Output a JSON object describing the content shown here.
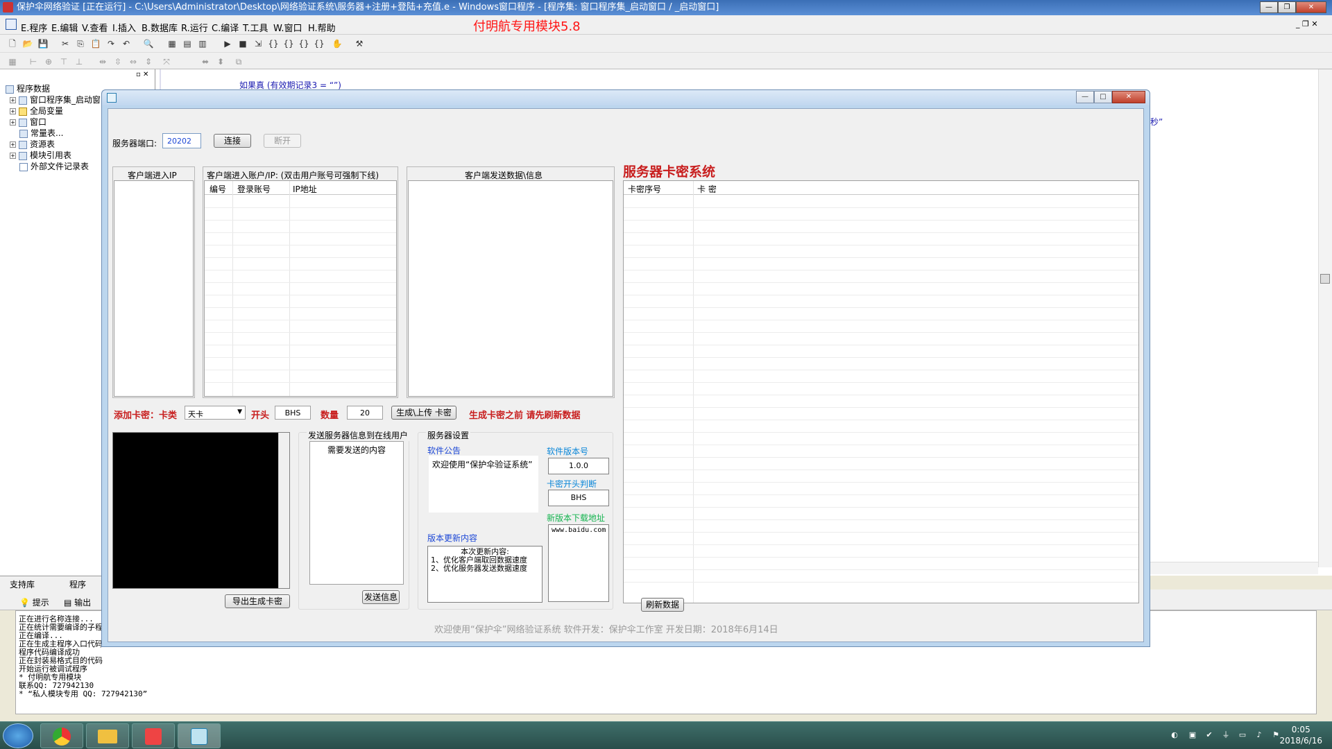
{
  "ide": {
    "title": "保护伞网络验证 [正在运行] - C:\\Users\\Administrator\\Desktop\\网络验证系统\\服务器+注册+登陆+充值.e - Windows窗口程序 - [程序集: 窗口程序集_启动窗口 / _启动窗口]",
    "menu": [
      "E.程序",
      "E.编辑",
      "V.查看",
      "I.插入",
      "B.数据库",
      "R.运行",
      "C.编译",
      "T.工具",
      "W.窗口",
      "H.帮助"
    ],
    "red_label": "付明航专用模块5.8",
    "tree": {
      "root": "程序数据",
      "items": [
        "窗口程序集_启动窗",
        "全局变量",
        "窗口",
        "常量表...",
        "资源表",
        "模块引用表",
        "外部文件记录表"
      ]
    },
    "left_tabs": [
      "支持库",
      "程序"
    ],
    "code_line": "如果真 (有效期记录3 = “”)",
    "code_fragment": "秒”",
    "output_tabs": [
      "提示",
      "输出"
    ],
    "output_lines": [
      "正在进行名称连接...",
      "正在统计需要编译的子程序",
      "正在编译...",
      "正在生成主程序入口代码",
      "程序代码编译成功",
      "正在封装易格式目的代码",
      "开始运行被调试程序",
      "* 付明航专用模块",
      "联系QQ: 727942130",
      "* “私人模块专用 QQ: 727942130”"
    ],
    "clock_time": "0:05",
    "clock_date": "2018/6/16"
  },
  "dialog": {
    "controls": {
      "minimize": "—",
      "maximize": "□",
      "close": "✕"
    },
    "port_label": "服务器端口:",
    "port_value": "20202",
    "connect_label": "连接",
    "disconnect_label": "断开",
    "client_ip_title": "客户端进入IP",
    "client_accounts_title": "客户端进入账户/IP: (双击用户账号可强制下线)",
    "client_accounts_columns": [
      "编号",
      "登录账号",
      "IP地址"
    ],
    "client_data_title": "客户端发送数据\\信息",
    "server_card_title": "服务器卡密系统",
    "card_columns": [
      "卡密序号",
      "卡 密"
    ],
    "add_card_label": "添加卡密：卡类",
    "card_type_value": "天卡",
    "prefix_label": "开头",
    "prefix_value": "BHS",
    "count_label": "数量",
    "count_value": "20",
    "generate_button": "生成\\上传 卡密",
    "generate_hint": "生成卡密之前 请先刷新数据",
    "send_title": "发送服务器信息到在线用户",
    "send_content": "需要发送的内容",
    "send_button": "发送信息",
    "export_button": "导出生成卡密",
    "server_settings_title": "服务器设置",
    "notice_label": "软件公告",
    "notice_value": "欢迎使用“保护伞验证系统”",
    "version_label": "软件版本号",
    "version_value": "1.0.0",
    "card_prefix_check_label": "卡密开头判断",
    "card_prefix_check_value": "BHS",
    "download_label": "新版本下载地址",
    "download_value": "www.baidu.com",
    "update_label": "版本更新内容",
    "update_lines": [
      "本次更新内容:",
      "1、优化客户端取回数据速度",
      "2、优化服务器发送数据速度"
    ],
    "refresh_button": "刷新数据",
    "footer": "欢迎使用“保护伞”网络验证系统  软件开发：保护伞工作室  开发日期：2018年6月14日"
  }
}
